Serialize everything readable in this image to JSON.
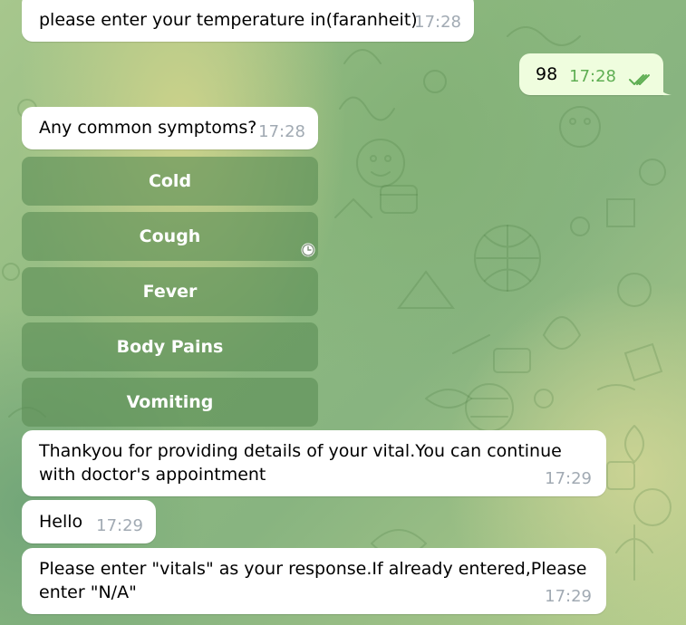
{
  "chat": {
    "messages": [
      {
        "text": "please enter your temperature in(faranheit)",
        "time": "17:28"
      },
      {
        "text": "98",
        "time": "17:28"
      },
      {
        "text": "Any common symptoms?",
        "time": "17:28"
      },
      {
        "text": "Thankyou for providing details of your vital.You can continue with doctor's appointment",
        "time": "17:29"
      },
      {
        "text": "Hello",
        "time": "17:29"
      },
      {
        "text": "Please enter \"vitals\" as your response.If already entered,Please enter \"N/A\"",
        "time": "17:29"
      }
    ],
    "keyboard_buttons": [
      "Cold",
      "Cough",
      "Fever",
      "Body Pains",
      "Vomiting"
    ],
    "icons": {
      "read_receipt": "double-check-icon",
      "pending": "clock-icon"
    },
    "colors": {
      "incoming_bubble": "#ffffff",
      "outgoing_bubble": "#effdde",
      "outgoing_time": "#5fae53",
      "incoming_time": "#a1aab3"
    }
  }
}
